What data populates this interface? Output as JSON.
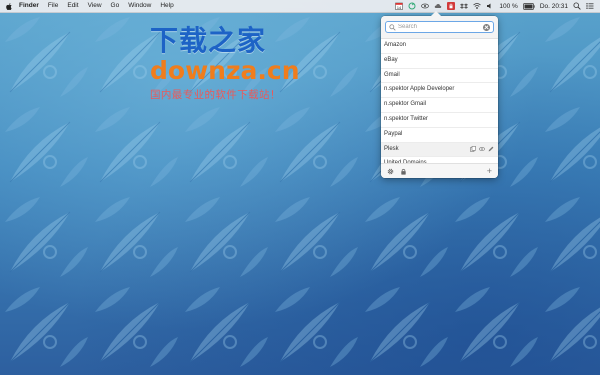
{
  "menubar": {
    "app_name": "Finder",
    "items": [
      "File",
      "Edit",
      "View",
      "Go",
      "Window",
      "Help"
    ],
    "status": {
      "calendar_day": "14",
      "battery": "100 %",
      "clock": "Do. 20:31"
    }
  },
  "watermark": {
    "title": "下载之家",
    "domain": "downza.cn",
    "tagline": "国内最专业的软件下载站！"
  },
  "popover": {
    "search_placeholder": "Search",
    "entries": [
      {
        "label": "Amazon"
      },
      {
        "label": "eBay"
      },
      {
        "label": "Gmail"
      },
      {
        "label": "n.spektor Apple Developer"
      },
      {
        "label": "n.spektor Gmail"
      },
      {
        "label": "n.spektor Twitter"
      },
      {
        "label": "Paypal"
      },
      {
        "label": "Plesk",
        "selected": true
      },
      {
        "label": "United Domains"
      }
    ],
    "footer_add": "+"
  },
  "colors": {
    "accent": "#6ca7e6",
    "wallpaper_top": "#5aa3cc",
    "wallpaper_bottom": "#2d5f9f"
  }
}
